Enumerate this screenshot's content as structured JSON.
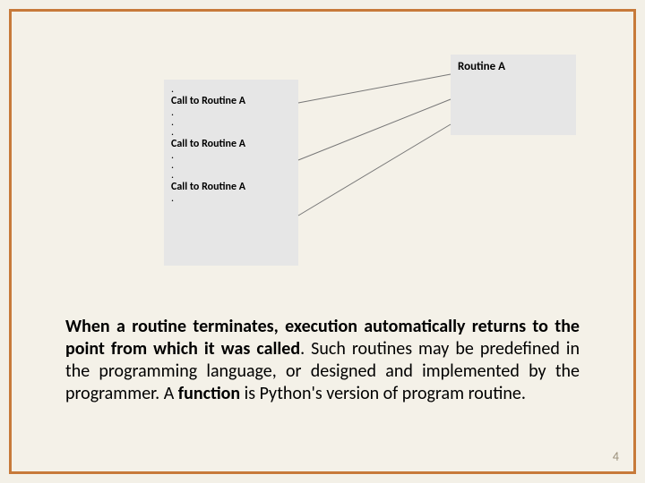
{
  "diagram": {
    "callee_title": "Routine A",
    "call1": "Call to Routine A",
    "call2": "Call to Routine A",
    "call3": "Call to Routine A"
  },
  "body": {
    "sent1_bold": "When a routine terminates, execution automatically returns to the point from which it was called",
    "sent1_rest": ". Such routines may be predefined in the programming language, or designed and implemented by the programmer.  A ",
    "function_word": "function",
    "sent1_end": " is Python's version of program routine."
  },
  "page_number": "4"
}
